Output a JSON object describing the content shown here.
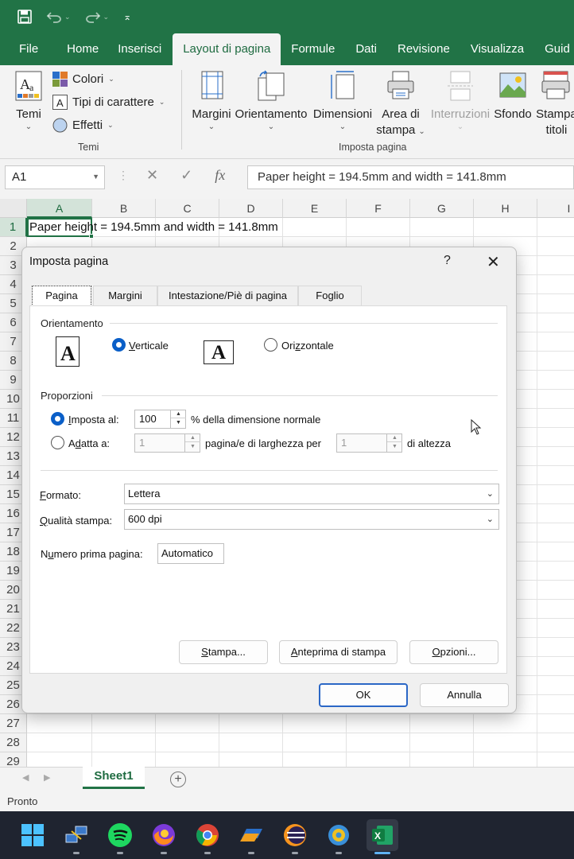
{
  "titlebar": {
    "save_icon": "save-icon",
    "undo_icon": "undo-icon",
    "redo_icon": "redo-icon",
    "customize_icon": "customize-quick-access-icon"
  },
  "ribbon_tabs": [
    "File",
    "Home",
    "Inserisci",
    "Layout di pagina",
    "Formule",
    "Dati",
    "Revisione",
    "Visualizza",
    "Guid"
  ],
  "ribbon": {
    "temi": {
      "label": "Temi",
      "group_label": "Temi"
    },
    "colori": "Colori",
    "tipi_carattere": "Tipi di carattere",
    "effetti": "Effetti",
    "margini": "Margini",
    "orientamento": "Orientamento",
    "dimensioni": "Dimensioni",
    "area_stampa_1": "Area di",
    "area_stampa_2": "stampa",
    "interruzioni": "Interruzioni",
    "sfondo": "Sfondo",
    "stampa_titoli_1": "Stampa",
    "stampa_titoli_2": "titoli",
    "imposta_pagina_group": "Imposta pagina"
  },
  "formula_bar": {
    "namebox": "A1",
    "formula": "Paper height = 194.5mm and width = 141.8mm"
  },
  "grid": {
    "columns": [
      "A",
      "B",
      "C",
      "D",
      "E",
      "F",
      "G",
      "H",
      "I"
    ],
    "rows": [
      "1",
      "2",
      "3",
      "4",
      "5",
      "6",
      "7",
      "8",
      "9",
      "10",
      "11",
      "12",
      "13",
      "14",
      "15",
      "16",
      "17",
      "18",
      "19",
      "20",
      "21",
      "22",
      "23",
      "24",
      "25",
      "26",
      "27",
      "28",
      "29"
    ],
    "a1": "Paper height = 194.5mm and width = 141.8mm"
  },
  "sheet_tab": "Sheet1",
  "status": "Pronto",
  "dialog": {
    "title": "Imposta pagina",
    "help": "?",
    "close": "✕",
    "tabs": [
      "Pagina",
      "Margini",
      "Intestazione/Piè di pagina",
      "Foglio"
    ],
    "orientamento_label": "Orientamento",
    "verticale_pre": "",
    "verticale_u": "V",
    "verticale_post": "erticale",
    "orizzontale_pre": "Ori",
    "orizzontale_u": "z",
    "orizzontale_post": "zontale",
    "proporzioni_label": "Proporzioni",
    "imposta_al_u": "I",
    "imposta_al_post": "mposta al:",
    "imposta_value": "100",
    "percent_text": "% della dimensione normale",
    "adatta_pre": "A",
    "adatta_u": "d",
    "adatta_post": "atta a:",
    "adatta_width_value": "1",
    "pagine_text": "pagina/e di larghezza per",
    "adatta_height_value": "1",
    "altezza_text": "di altezza",
    "formato_u": "F",
    "formato_post": "ormato:",
    "formato_value": "Lettera",
    "qualita_u": "Q",
    "qualita_post": "ualità stampa:",
    "qualita_value": "600 dpi",
    "numero_pre": "N",
    "numero_u": "u",
    "numero_post": "mero prima pagina:",
    "numero_value": "Automatico",
    "stampa_u": "S",
    "stampa_post": "tampa...",
    "anteprima_pre": "",
    "anteprima_u": "A",
    "anteprima_post": "nteprima di stampa",
    "opzioni_u": "O",
    "opzioni_post": "pzioni...",
    "ok": "OK",
    "annulla": "Annulla"
  },
  "taskbar": [
    "windows-start-icon",
    "network-icon",
    "spotify-icon",
    "firefox-icon",
    "chrome-icon",
    "app-icon",
    "eclipse-icon",
    "settings-app-icon",
    "excel-icon"
  ],
  "colors": {
    "excel_green": "#217346",
    "accent_blue": "#0a5fc8"
  }
}
